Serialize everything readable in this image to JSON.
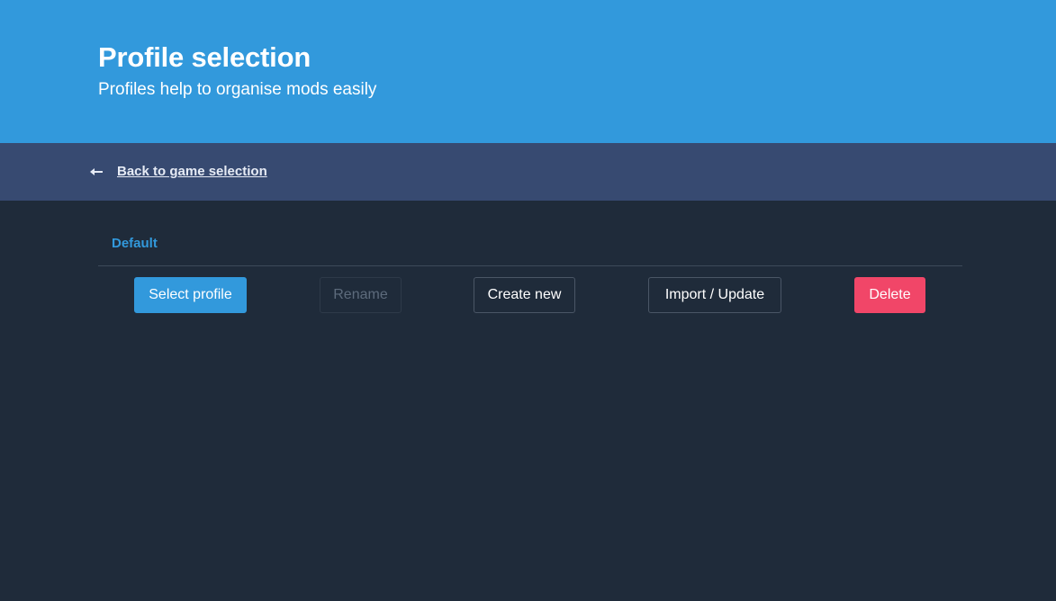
{
  "header": {
    "title": "Profile selection",
    "subtitle": "Profiles help to organise mods easily"
  },
  "nav": {
    "back_label": "Back to game selection",
    "back_icon": "arrow-left-icon"
  },
  "profiles": {
    "selected_name": "Default"
  },
  "actions": {
    "select_label": "Select profile",
    "rename_label": "Rename",
    "create_label": "Create new",
    "import_label": "Import / Update",
    "delete_label": "Delete"
  },
  "colors": {
    "hero": "#3299dc",
    "nav": "#374a71",
    "background": "#1f2b3a",
    "primary": "#3299dc",
    "danger": "#f14668"
  }
}
